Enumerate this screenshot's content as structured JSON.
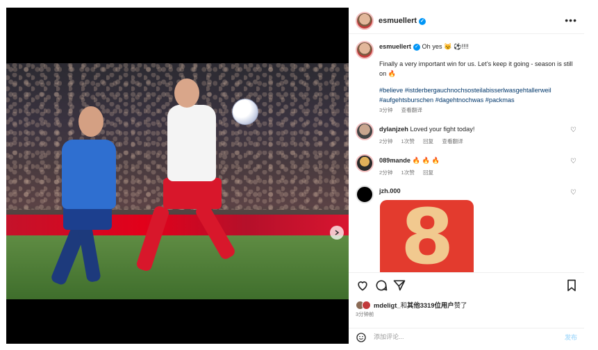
{
  "post": {
    "username": "esmuellert",
    "more_icon": "more-horizontal-icon",
    "caption_first": "Oh yes 😼 ⚽!!!!",
    "caption_body": "Finally a very important win for us. Let’s keep it going - season is still on 🔥",
    "hashtags": "#believe #istderbergauchnochsosteilabisserlwasgehtallerweil #aufgehtsburschen #dagehtnochwas #packmas",
    "time": "3分钟",
    "translate": "查看翻译"
  },
  "comments": [
    {
      "user": "dylanjzeh",
      "text": "Loved your fight today!",
      "time": "2分钟",
      "likes": "1次赞",
      "reply": "回复",
      "translate": "查看翻译"
    },
    {
      "user": "089mande",
      "text": "🔥 🔥 🔥",
      "time": "2分钟",
      "likes": "1次赞",
      "reply": "回复"
    },
    {
      "user": "jzh.000",
      "image_text": "8"
    }
  ],
  "likes_line": {
    "user": "mdeligt_",
    "connector": "和",
    "others": "其他3319位用户",
    "suffix": "赞了"
  },
  "time_ago": "3分钟前",
  "comment_bar": {
    "placeholder": "添加评论...",
    "post_label": "发布"
  },
  "carousel": {
    "slides": 3,
    "active": 0
  },
  "colors": {
    "accent": "#0095f6",
    "link": "#00376b",
    "muted": "#737373"
  }
}
